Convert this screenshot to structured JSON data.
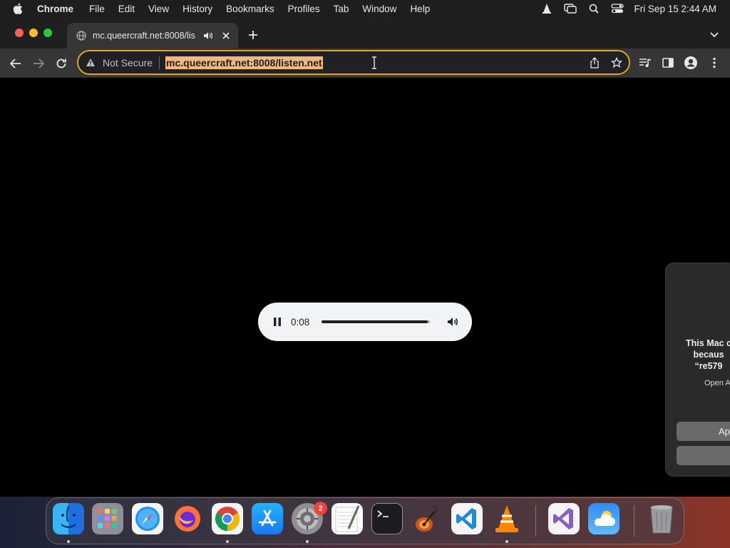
{
  "menubar": {
    "app_name": "Chrome",
    "items": [
      "File",
      "Edit",
      "View",
      "History",
      "Bookmarks",
      "Profiles",
      "Tab",
      "Window",
      "Help"
    ],
    "clock": "Fri Sep 15  2:44 AM"
  },
  "tab": {
    "title": "mc.queercraft.net:8008/lis",
    "audio_playing": true
  },
  "omnibox": {
    "security_label": "Not Secure",
    "url": "mc.queercraft.net:8008/listen.net",
    "focus_color": "#e0a41f",
    "selection_color": "#f0b77e"
  },
  "audio_player": {
    "time": "0:08",
    "progress": 0.98,
    "state": "playing"
  },
  "dialog": {
    "line1": "This Mac c",
    "line2": "becaus",
    "line3": "“re579",
    "sub": "Open A",
    "primary_button": "Ap"
  },
  "dock": {
    "apps": [
      "finder-icon",
      "launchpad-icon",
      "safari-icon",
      "firefox-icon",
      "chrome-icon",
      "app-store-icon",
      "system-settings-icon",
      "textedit-icon",
      "terminal-icon",
      "garageband-icon",
      "vscode-icon",
      "vlc-icon",
      "visual-studio-icon",
      "weather-icon",
      "trash-icon"
    ],
    "system_settings_badge": "2"
  }
}
